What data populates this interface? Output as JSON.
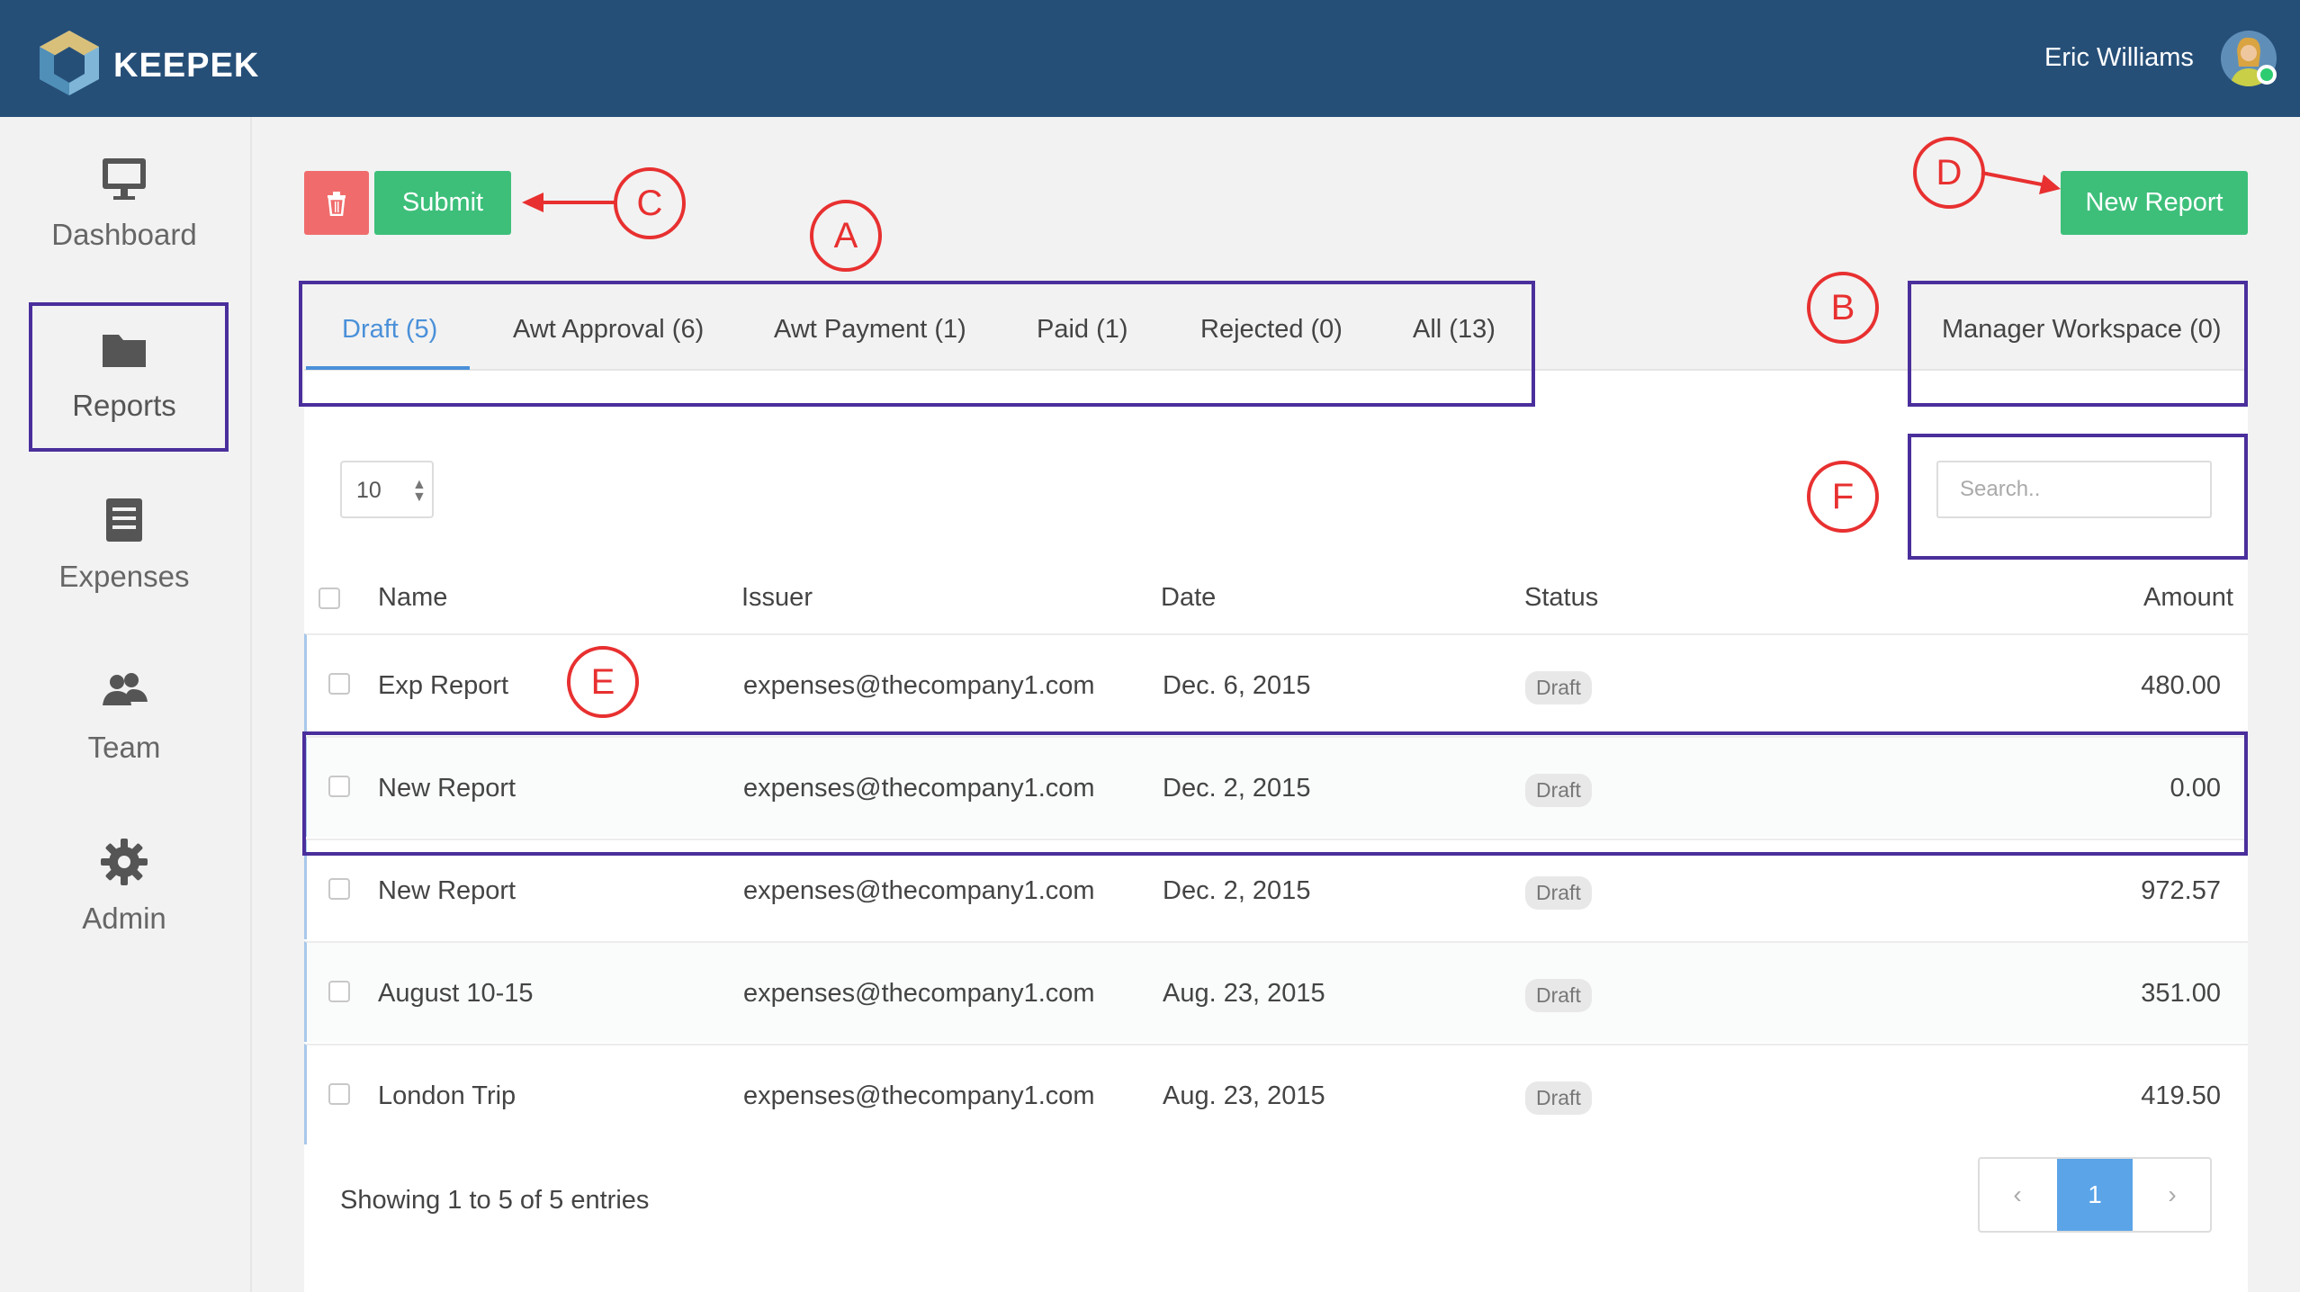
{
  "app": {
    "brand": "KEEPEK",
    "user_name": "Eric Williams"
  },
  "sidebar": {
    "items": [
      {
        "label": "Dashboard",
        "icon": "monitor-icon"
      },
      {
        "label": "Reports",
        "icon": "folder-icon",
        "active": true
      },
      {
        "label": "Expenses",
        "icon": "document-icon"
      },
      {
        "label": "Team",
        "icon": "team-icon"
      },
      {
        "label": "Admin",
        "icon": "gear-icon"
      }
    ]
  },
  "toolbar": {
    "submit_label": "Submit",
    "new_report_label": "New Report",
    "delete_icon": "trash-icon"
  },
  "tabs": [
    {
      "label": "Draft (5)",
      "active": true
    },
    {
      "label": "Awt Approval (6)"
    },
    {
      "label": "Awt Payment (1)"
    },
    {
      "label": "Paid (1)"
    },
    {
      "label": "Rejected (0)"
    },
    {
      "label": "All (13)"
    }
  ],
  "manager_tab": "Manager Workspace (0)",
  "table": {
    "page_size": "10",
    "search_placeholder": "Search..",
    "columns": [
      "Name",
      "Issuer",
      "Date",
      "Status",
      "Amount"
    ],
    "rows": [
      {
        "name": "Exp Report",
        "issuer": "expenses@thecompany1.com",
        "date": "Dec. 6, 2015",
        "status": "Draft",
        "amount": "480.00"
      },
      {
        "name": "New Report",
        "issuer": "expenses@thecompany1.com",
        "date": "Dec. 2, 2015",
        "status": "Draft",
        "amount": "0.00"
      },
      {
        "name": "New Report",
        "issuer": "expenses@thecompany1.com",
        "date": "Dec. 2, 2015",
        "status": "Draft",
        "amount": "972.57"
      },
      {
        "name": "August 10-15",
        "issuer": "expenses@thecompany1.com",
        "date": "Aug. 23, 2015",
        "status": "Draft",
        "amount": "351.00"
      },
      {
        "name": "London Trip",
        "issuer": "expenses@thecompany1.com",
        "date": "Aug. 23, 2015",
        "status": "Draft",
        "amount": "419.50"
      }
    ],
    "footer": "Showing 1 to 5 of 5 entries",
    "pagination": {
      "prev": "‹",
      "current": "1",
      "next": "›"
    }
  },
  "annotations": {
    "a": "A",
    "b": "B",
    "c": "C",
    "d": "D",
    "e": "E",
    "f": "F"
  },
  "colors": {
    "header": "#264f78",
    "accent_green": "#3dbf7a",
    "danger": "#f06c6c",
    "link_blue": "#4a90d9",
    "annotation_red": "#e83030",
    "annotation_box": "#4a2f9c"
  }
}
